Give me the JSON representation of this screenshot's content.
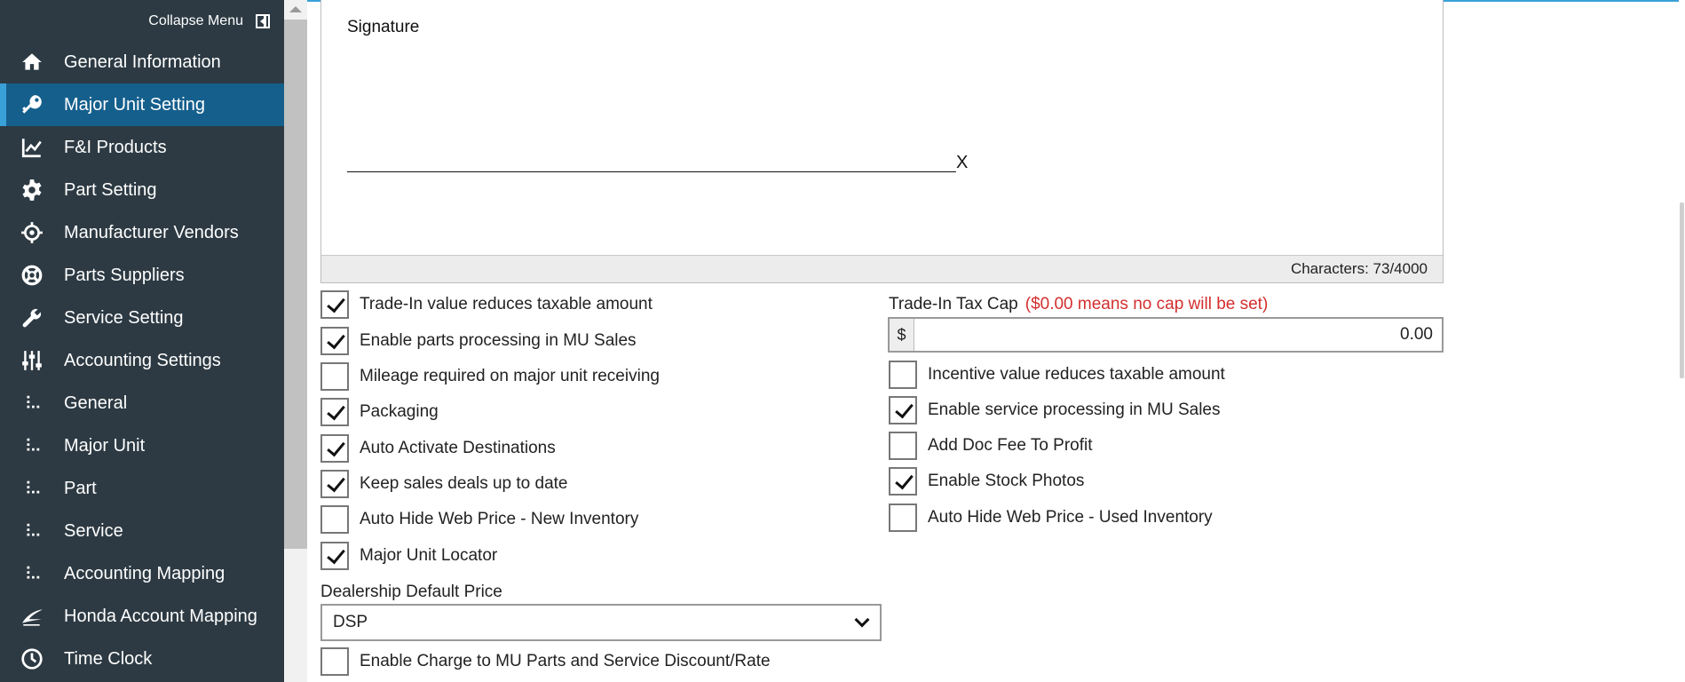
{
  "sidebar": {
    "collapse_label": "Collapse Menu",
    "items": [
      {
        "label": "General Information",
        "icon": "home-icon"
      },
      {
        "label": "Major Unit Setting",
        "icon": "key-icon"
      },
      {
        "label": "F&I Products",
        "icon": "line-chart-icon"
      },
      {
        "label": "Part Setting",
        "icon": "gear-icon"
      },
      {
        "label": "Manufacturer Vendors",
        "icon": "crosshair-icon"
      },
      {
        "label": "Parts Suppliers",
        "icon": "lifebuoy-icon"
      },
      {
        "label": "Service Setting",
        "icon": "wrench-icon"
      },
      {
        "label": "Accounting Settings",
        "icon": "sliders-icon"
      },
      {
        "label": "General",
        "icon": "sub-list-icon"
      },
      {
        "label": "Major Unit",
        "icon": "sub-list-icon"
      },
      {
        "label": "Part",
        "icon": "sub-list-icon"
      },
      {
        "label": "Service",
        "icon": "sub-list-icon"
      },
      {
        "label": "Accounting Mapping",
        "icon": "sub-list-icon"
      },
      {
        "label": "Honda Account Mapping",
        "icon": "honda-wing-icon"
      },
      {
        "label": "Time Clock",
        "icon": "clock-icon"
      }
    ],
    "active_index": 1
  },
  "signature": {
    "title": "Signature",
    "x_mark": "X",
    "characters": "Characters: 73/4000"
  },
  "checkboxes_left": [
    {
      "label": "Trade-In value reduces taxable amount",
      "checked": true
    },
    {
      "label": "Enable parts processing in MU Sales",
      "checked": true
    },
    {
      "label": "Mileage required on major unit receiving",
      "checked": false
    },
    {
      "label": "Packaging",
      "checked": true
    },
    {
      "label": "Auto Activate Destinations",
      "checked": true
    },
    {
      "label": "Keep sales deals up to date",
      "checked": true
    },
    {
      "label": "Auto Hide Web Price - New Inventory",
      "checked": false
    },
    {
      "label": "Major Unit Locator",
      "checked": true
    }
  ],
  "trade_in_tax_cap": {
    "label": "Trade-In Tax Cap",
    "note": "($0.00 means no cap will be set)",
    "prefix": "$",
    "value": "0.00",
    "note_color": "#d32f2f"
  },
  "checkboxes_right": [
    {
      "label": "Incentive value reduces taxable amount",
      "checked": false
    },
    {
      "label": "Enable service processing in MU Sales",
      "checked": true
    },
    {
      "label": "Add Doc Fee To Profit",
      "checked": false
    },
    {
      "label": "Enable Stock Photos",
      "checked": true
    },
    {
      "label": "Auto Hide Web Price - Used Inventory",
      "checked": false
    }
  ],
  "dealership_default_price": {
    "label": "Dealership Default Price",
    "selected": "DSP"
  },
  "enable_charge": {
    "label": "Enable Charge to MU Parts and Service Discount/Rate",
    "checked": false
  },
  "colors": {
    "sidebar_bg": "#2d3a43",
    "active_bg": "#155f8d",
    "accent": "#3aa0d8"
  }
}
